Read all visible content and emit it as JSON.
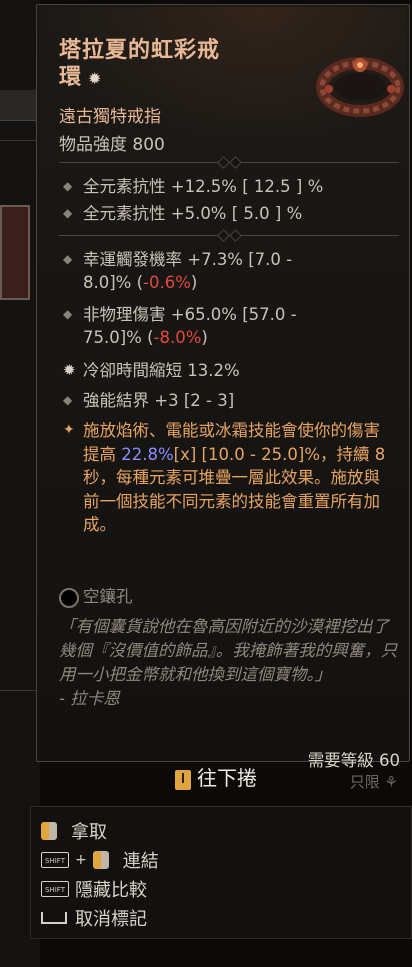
{
  "item": {
    "name_line1": "塔拉夏的虹彩戒",
    "name_line2": "環",
    "name_star": "✹",
    "subtitle": "遠古獨特戒指",
    "power": "物品強度 800"
  },
  "implicit_stats": [
    "全元素抗性 +12.5%  [ 12.5 ] %",
    "全元素抗性 +5.0%  [ 5.0 ] %"
  ],
  "affixes": {
    "lucky_hit_pre": "幸運觸發機率 +7.3% [7.0 -",
    "lucky_hit_post": "8.0]% (",
    "lucky_hit_delta": "-0.6%",
    "lucky_hit_close": ")",
    "nonphys_pre": "非物理傷害 +65.0% [57.0 -",
    "nonphys_post": "75.0]% (",
    "nonphys_delta": "-8.0%",
    "nonphys_close": ")",
    "cdr": "冷卻時間縮短 13.2%",
    "enhanced": "強能結界 +3 [2 - 3]"
  },
  "legendary": {
    "part1": "施放焰術、電能或冰霜技能會使你的傷害提高 ",
    "value": "22.8%",
    "part2": "[x] [10.0 - 25.0]%，持續 8 秒，每種元素可堆疊一層此效果。施放與前一個技能不同元素的技能會重置所有加成。"
  },
  "socket_label": "空鑲孔",
  "flavor": {
    "text": "「有個囊貨說他在魯高因附近的沙漠裡挖出了幾個『沒價值的飾品』。我掩飾著我的興奮，只用一小把金幣就和他換到這個寶物。」",
    "author": "- 拉卡恩"
  },
  "requirements": {
    "level": "需要等級 60",
    "account_bound": "只限 ⚘"
  },
  "scroll_hint": "往下捲",
  "actions": {
    "pick_up": "拿取",
    "link": "連結",
    "hide_compare": "隱藏比較",
    "unmark": "取消標記",
    "shift_key": "SHIFT"
  },
  "colors": {
    "unique_orange": "#e8b896",
    "legendary_text": "#e6a462",
    "negative_red": "#e0493e",
    "highlight_blue": "#8a8cff"
  }
}
